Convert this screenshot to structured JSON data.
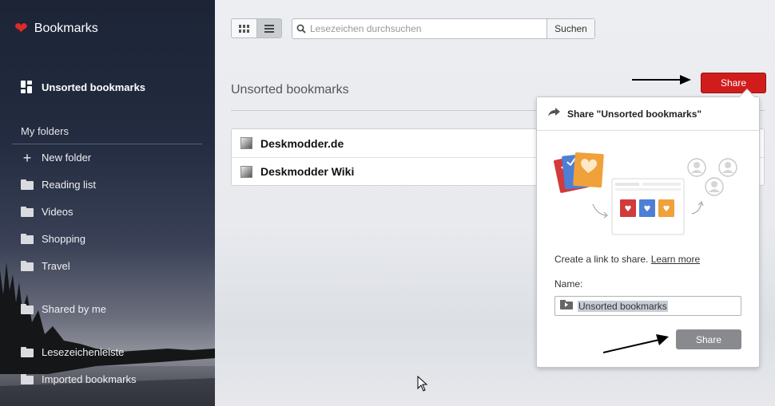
{
  "sidebar": {
    "brand": "Bookmarks",
    "unsorted": "Unsorted bookmarks",
    "my_folders": "My folders",
    "new_folder": "New folder",
    "folders": [
      "Reading list",
      "Videos",
      "Shopping",
      "Travel"
    ],
    "shared": "Shared by me",
    "bottom_folders": [
      "Lesezeichenleiste",
      "Imported bookmarks"
    ]
  },
  "toolbar": {
    "search_placeholder": "Lesezeichen durchsuchen",
    "search_button": "Suchen"
  },
  "main": {
    "title": "Unsorted bookmarks",
    "share_button": "Share",
    "bookmarks": [
      "Deskmodder.de",
      "Deskmodder Wiki"
    ]
  },
  "popup": {
    "title": "Share \"Unsorted bookmarks\"",
    "description": "Create a link to share.",
    "learn_more": "Learn more",
    "name_label": "Name:",
    "name_value": "Unsorted bookmarks",
    "share_button": "Share"
  },
  "colors": {
    "accent": "#d11c1c",
    "heart": "#e02a2a"
  }
}
